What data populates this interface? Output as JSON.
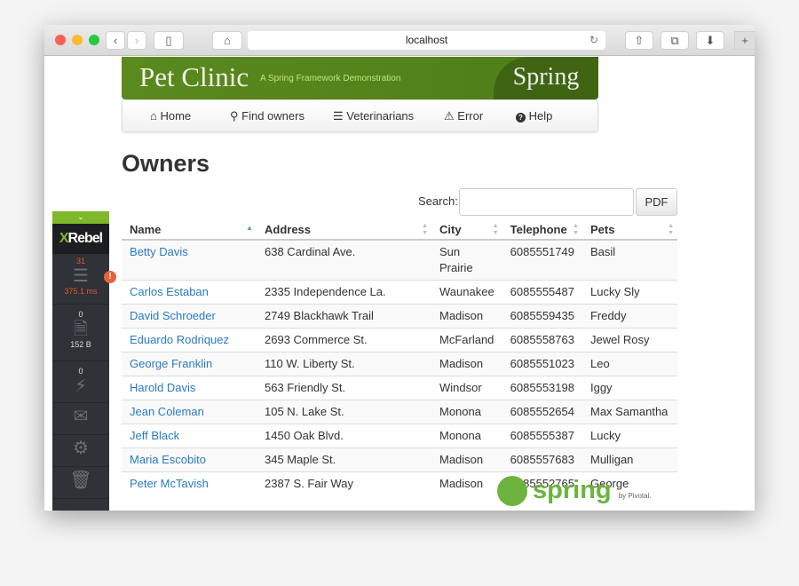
{
  "browser": {
    "url": "localhost"
  },
  "banner": {
    "title": "Pet Clinic",
    "subtitle": "A Spring Framework Demonstration",
    "logo": "Spring"
  },
  "nav": [
    {
      "icon": "home-icon",
      "glyph": "⌂",
      "label": "Home"
    },
    {
      "icon": "search-icon",
      "glyph": "🔍︎",
      "label": "Find owners"
    },
    {
      "icon": "list-icon",
      "glyph": "☰",
      "label": "Veterinarians"
    },
    {
      "icon": "warning-icon",
      "glyph": "⚠",
      "label": "Error"
    },
    {
      "icon": "help-icon",
      "glyph": "?",
      "label": "Help"
    }
  ],
  "page": {
    "title": "Owners",
    "search_label": "Search:",
    "search_value": "",
    "pdf_label": "PDF"
  },
  "table": {
    "headers": [
      "Name",
      "Address",
      "City",
      "Telephone",
      "Pets"
    ],
    "rows": [
      [
        "Betty Davis",
        "638 Cardinal Ave.",
        "Sun Prairie",
        "6085551749",
        "Basil"
      ],
      [
        "Carlos Estaban",
        "2335 Independence La.",
        "Waunakee",
        "6085555487",
        "Lucky Sly"
      ],
      [
        "David Schroeder",
        "2749 Blackhawk Trail",
        "Madison",
        "6085559435",
        "Freddy"
      ],
      [
        "Eduardo Rodriquez",
        "2693 Commerce St.",
        "McFarland",
        "6085558763",
        "Jewel Rosy"
      ],
      [
        "George Franklin",
        "110 W. Liberty St.",
        "Madison",
        "6085551023",
        "Leo"
      ],
      [
        "Harold Davis",
        "563 Friendly St.",
        "Windsor",
        "6085553198",
        "Iggy"
      ],
      [
        "Jean Coleman",
        "105 N. Lake St.",
        "Monona",
        "6085552654",
        "Max Samantha"
      ],
      [
        "Jeff Black",
        "1450 Oak Blvd.",
        "Monona",
        "6085555387",
        "Lucky"
      ],
      [
        "Maria Escobito",
        "345 Maple St.",
        "Madison",
        "6085557683",
        "Mulligan"
      ],
      [
        "Peter McTavish",
        "2387 S. Fair Way",
        "Madison",
        "6085552765",
        "George"
      ]
    ]
  },
  "xrebel": {
    "logo_x": "X",
    "logo_rest": "Rebel",
    "db_count": "31",
    "db_time": "375.1 ms",
    "io_count": "0",
    "io_size": "152 B",
    "async_count": "0",
    "accent": "#7fb82a",
    "alert": "#e8603c"
  },
  "footer": {
    "logo": "spring",
    "by": "by Pivotal."
  }
}
